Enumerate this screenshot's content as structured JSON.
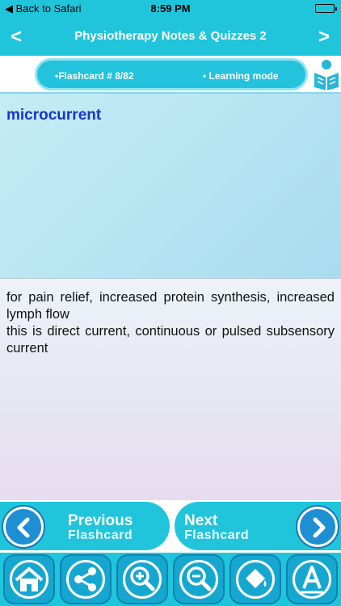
{
  "status_bar": {
    "back_label": "◀ Back to Safari",
    "time": "8:59 PM"
  },
  "header": {
    "title": "Physiotherapy Notes & Quizzes 2",
    "prev_glyph": "<",
    "next_glyph": ">"
  },
  "info": {
    "flashcard": "•Flashcard #  8/82",
    "mode": "• Learning mode"
  },
  "card": {
    "term": "microcurrent",
    "definition_1": "for pain relief, increased protein synthesis, increased lymph flow",
    "definition_2": "this is direct current, continuous or pulsed subsensory current"
  },
  "navigation": {
    "prev_line1": "Previous",
    "prev_line2": "Flashcard",
    "next_line1": "Next",
    "next_line2": "Flashcard"
  },
  "toolbar": {
    "icons": [
      "home-icon",
      "share-icon",
      "zoom-in-icon",
      "zoom-out-icon",
      "paint-bucket-icon",
      "font-icon"
    ]
  },
  "colors": {
    "accent": "#20c5dc",
    "term_text": "#1736c9",
    "nav_circle": "#1d8fd2"
  }
}
